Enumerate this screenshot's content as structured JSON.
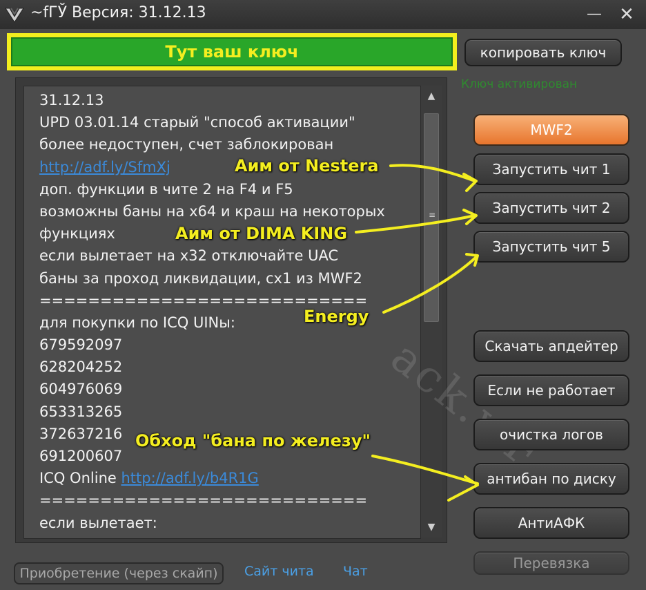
{
  "window": {
    "title": "~fГЎ Версия: 31.12.13",
    "minimize": "—",
    "close": "✕"
  },
  "key_field": {
    "value": "Тут ваш ключ"
  },
  "copy_button": "копировать ключ",
  "status_text": "Ключ активирован",
  "mode_button": "MWF2",
  "cheat_buttons": [
    "Запустить чит 1",
    "Запустить чит 2",
    "Запустить чит 5"
  ],
  "tool_buttons": {
    "updater": "Скачать апдейтер",
    "not_working": "Если не работает",
    "clear_logs": "очистка логов",
    "antiban": "антибан по диску",
    "antiafk": "АнтиАФК",
    "rebind": "Перевязка"
  },
  "text_lines": [
    "31.12.13",
    "UPD 03.01.14 старый \"способ активации\"",
    "более недоступен, счет заблокирован",
    "http://adf.ly/SfmXj",
    "доп. функции в чите 2 на F4 и F5",
    "возможны баны на x64 и краш на некоторых",
    "функциях",
    "если вылетает на x32 отключайте UAC",
    "баны за проход ликвидации, сх1 из MWF2",
    "===========================",
    "для покупки по ICQ UINы:",
    "679592097",
    "628204252",
    "604976069",
    "653313265",
    "372637216",
    "691200607",
    "ICQ Online ",
    "===========================",
    "если вылетает:"
  ],
  "icq_link": "http://adf.ly/b4R1G",
  "scroll": {
    "up": "▲",
    "down": "▼",
    "grip": "≡"
  },
  "watermark": "ack.wF",
  "annotations": {
    "nestera": "Аим от Nestera",
    "dima": "Аим от DIMA KING",
    "energy": "Energy",
    "hwid": "Обход \"бана по железу\""
  },
  "bottom": {
    "buy": "Приобретение (через скайп)",
    "site": "Сайт чита",
    "chat": "Чат"
  },
  "colors": {
    "key_bg": "#29a629",
    "key_frame": "#f2ee1e",
    "mode_button": "#e7752d",
    "link": "#3b8ad9",
    "annotation": "#f4ee20"
  }
}
